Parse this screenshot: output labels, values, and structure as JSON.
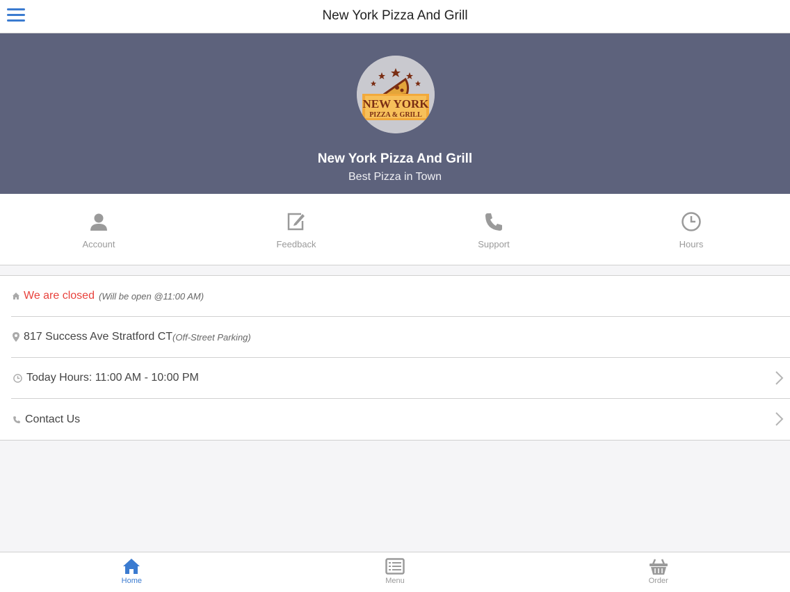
{
  "header": {
    "title": "New York Pizza And Grill",
    "menu_icon": "hamburger-menu-icon"
  },
  "hero": {
    "name": "New York Pizza And Grill",
    "tagline": "Best Pizza in Town",
    "logo": {
      "line1": "NEW YORK",
      "line2": "PIZZA & GRILL"
    }
  },
  "quicknav": [
    {
      "label": "Account",
      "icon": "user-icon"
    },
    {
      "label": "Feedback",
      "icon": "edit-icon"
    },
    {
      "label": "Support",
      "icon": "phone-icon"
    },
    {
      "label": "Hours",
      "icon": "clock-icon"
    }
  ],
  "info": {
    "status": {
      "text": "We are closed",
      "note": "(Will be open @11:00 AM)",
      "icon": "home-icon"
    },
    "address": {
      "text": "817 Success Ave Stratford CT",
      "note": "(Off-Street Parking)",
      "icon": "map-pin-icon"
    },
    "hours": {
      "text": "Today Hours: 11:00 AM - 10:00 PM",
      "icon": "clock-icon"
    },
    "contact": {
      "text": "Contact Us",
      "icon": "phone-icon"
    }
  },
  "bottom_tabs": [
    {
      "label": "Home",
      "icon": "home-icon",
      "active": true
    },
    {
      "label": "Menu",
      "icon": "menu-list-icon",
      "active": false
    },
    {
      "label": "Order",
      "icon": "basket-icon",
      "active": false
    }
  ],
  "colors": {
    "accent": "#3b7bd0",
    "hero_bg": "#5d627c",
    "closed": "#e8423c"
  }
}
